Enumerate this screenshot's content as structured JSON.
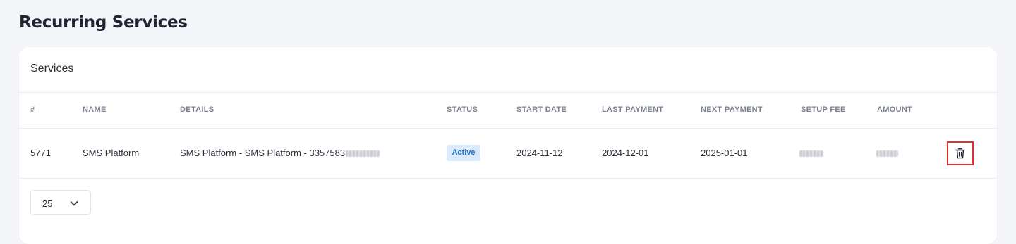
{
  "page": {
    "title": "Recurring Services"
  },
  "card": {
    "title": "Services"
  },
  "table": {
    "columns": [
      "#",
      "NAME",
      "DETAILS",
      "STATUS",
      "START DATE",
      "LAST PAYMENT",
      "NEXT PAYMENT",
      "SETUP FEE",
      "AMOUNT"
    ],
    "rows": [
      {
        "id": "5771",
        "name": "SMS Platform",
        "details": "SMS Platform - SMS Platform - 3357583",
        "status": "Active",
        "start_date": "2024-11-12",
        "last_payment": "2024-12-01",
        "next_payment": "2025-01-01",
        "delete_icon": "trash-icon"
      }
    ]
  },
  "pagination": {
    "page_size": "25",
    "dropdown_icon": "chevron-down-icon"
  },
  "colors": {
    "status_active_bg": "#d8eafb",
    "status_active_text": "#1f6fc9",
    "highlight": "#e03131"
  }
}
